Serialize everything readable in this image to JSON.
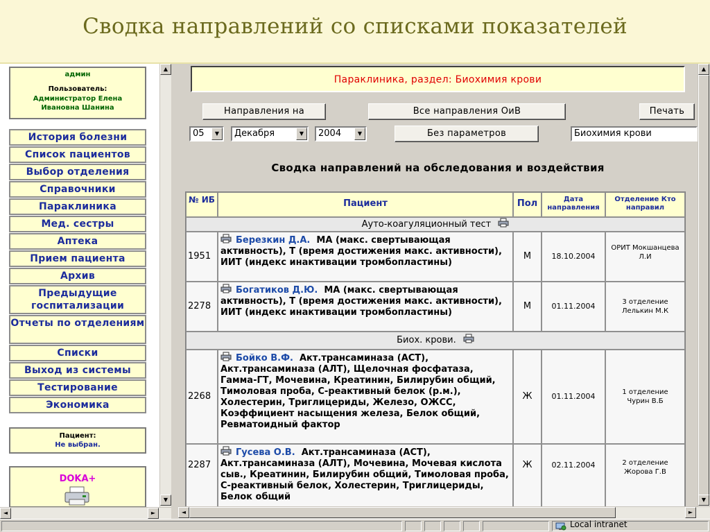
{
  "slide": {
    "title": "Сводка направлений со списками показателей"
  },
  "left_frame": {
    "user_role": "админ",
    "user_label": "Пользователь:",
    "user_name": "Администратор Елена Ивановна Шанина",
    "menu": [
      "История болезни",
      "Список пациентов",
      "Выбор отделения",
      "Справочники",
      "Параклиника",
      "Мед. сестры",
      "Аптека",
      "Прием пациента",
      "Архив",
      "Предыдущие госпитализации",
      "Отчеты по отделениям",
      "Списки",
      "Выход из системы",
      "Тестирование",
      "Экономика"
    ],
    "patient_label": "Пациент:",
    "patient_value": "Не выбран.",
    "brand": "DOKA+"
  },
  "main": {
    "section_header": "Параклиника, раздел: Биохимия крови",
    "buttons": {
      "directions_on": "Направления на",
      "all_directions": "Все направления ОиВ",
      "print": "Печать",
      "no_params": "Без параметров"
    },
    "date": {
      "day": "05",
      "month": "Декабря",
      "year": "2004"
    },
    "filter_text": "Биохимия крови",
    "report_title": "Сводка направлений на обследования и воздействия",
    "table": {
      "headers": {
        "ib": "№ ИБ",
        "patient": "Пациент",
        "sex": "Пол",
        "date": "Дата направления",
        "dept": "Отделение Кто направил"
      },
      "groups": [
        {
          "title": "Ауто-коагуляционный тест",
          "rows": [
            {
              "ib": "1951",
              "name": "Березкин Д.А.",
              "tests": "МА (макс. свертывающая активность), Т (время достижения макс. активности), ИИТ (индекс инактивации тромбопластины)",
              "sex": "М",
              "date": "18.10.2004",
              "dept": "ОРИТ Мокшанцева Л.И"
            },
            {
              "ib": "2278",
              "name": "Богатиков Д.Ю.",
              "tests": "МА (макс. свертывающая активность), Т (время достижения макс. активности), ИИТ (индекс инактивации тромбопластины)",
              "sex": "М",
              "date": "01.11.2004",
              "dept": "3 отделение Лелькин М.К"
            }
          ]
        },
        {
          "title": "Биох. крови.",
          "rows": [
            {
              "ib": "2268",
              "name": "Бойко В.Ф.",
              "tests": "Акт.трансаминаза (АСТ), Акт.трансаминаза (АЛТ), Щелочная фосфатаза, Гамма-ГТ, Мочевина, Креатинин, Билирубин общий, Тимоловая проба, С-реактивный белок (р.м.), Холестерин, Триглицериды, Железо, ОЖСС, Коэффициент насыщения железа, Белок общий, Ревматоидный фактор",
              "sex": "Ж",
              "date": "01.11.2004",
              "dept": "1 отделение Чурин В.Б"
            },
            {
              "ib": "2287",
              "name": "Гусева О.В.",
              "tests": "Акт.трансаминаза (АСТ), Акт.трансаминаза (АЛТ), Мочевина, Мочевая кислота сыв., Креатинин, Билирубин общий, Тимоловая проба, С-реактивный белок, Холестерин, Триглицериды, Белок общий",
              "sex": "Ж",
              "date": "02.11.2004",
              "dept": "2 отделение Жорова Г.В"
            }
          ]
        }
      ]
    }
  },
  "status_bar": {
    "zone": "Local intranet"
  },
  "colors": {
    "accent_blue": "#1c2c9c",
    "panel_yellow": "#ffffd0",
    "header_red": "#e00000",
    "brand_magenta": "#d800d8"
  }
}
